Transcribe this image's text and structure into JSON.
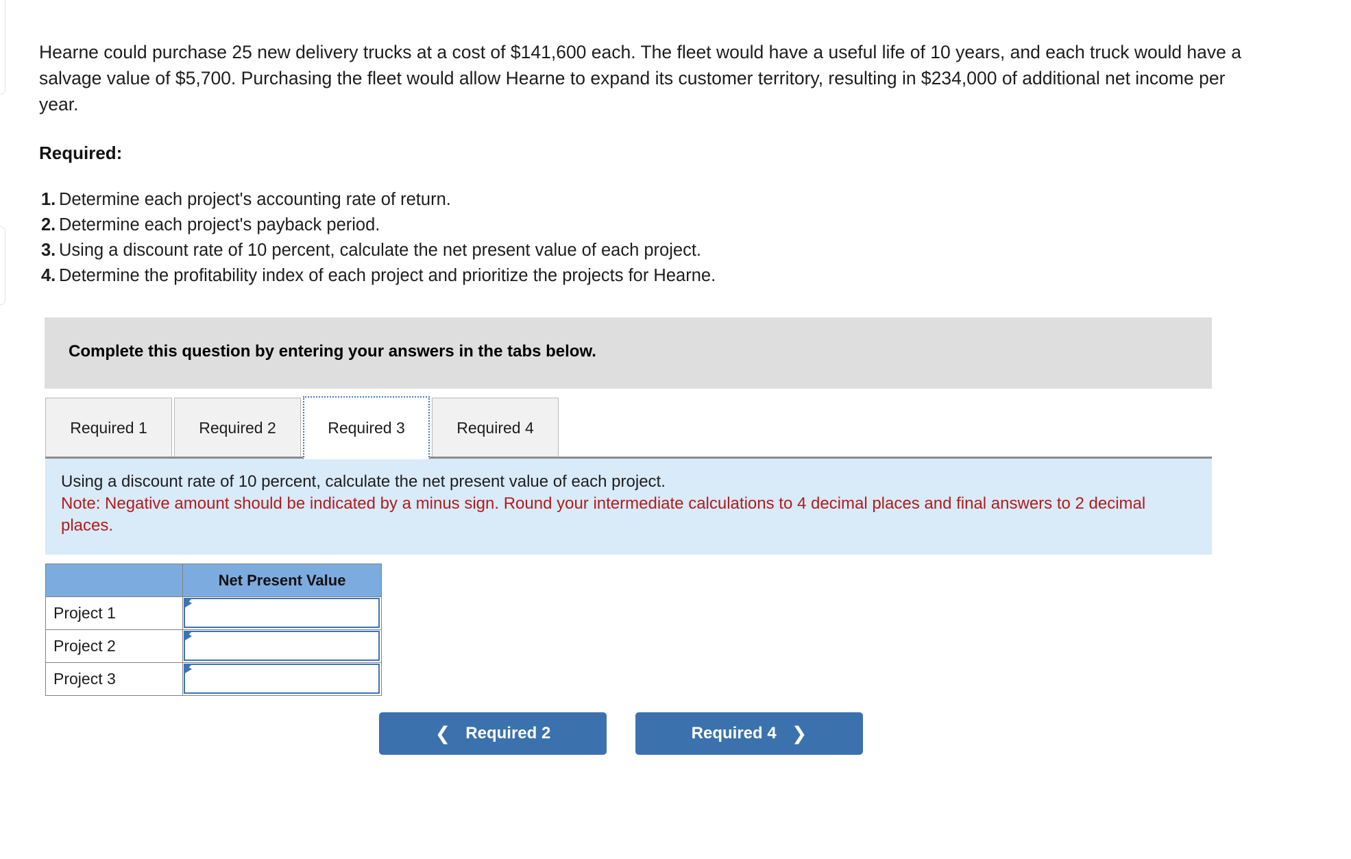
{
  "problem": {
    "paragraph": "Hearne could purchase 25 new delivery trucks at a cost of $141,600 each. The fleet would have a useful life of 10 years, and each truck would have a salvage value of $5,700. Purchasing the fleet would allow Hearne to expand its customer territory, resulting in $234,000 of additional net income per year.",
    "required_heading": "Required:",
    "required_items": [
      {
        "num": "1.",
        "text": "Determine each project's accounting rate of return."
      },
      {
        "num": "2.",
        "text": "Determine each project's payback period."
      },
      {
        "num": "3.",
        "text": "Using a discount rate of 10 percent, calculate the net present value of each project."
      },
      {
        "num": "4.",
        "text": "Determine the profitability index of each project and prioritize the projects for Hearne."
      }
    ]
  },
  "banner": {
    "text": "Complete this question by entering your answers in the tabs below."
  },
  "tabs": {
    "items": [
      {
        "label": "Required 1",
        "active": false
      },
      {
        "label": "Required 2",
        "active": false
      },
      {
        "label": "Required 3",
        "active": true
      },
      {
        "label": "Required 4",
        "active": false
      }
    ]
  },
  "instruction_panel": {
    "line1": "Using a discount rate of 10 percent, calculate the net present value of each project.",
    "note": "Note: Negative amount should be indicated by a minus sign. Round your intermediate calculations to 4 decimal places and final answers to 2 decimal places.",
    "note_color": "#b01c1c",
    "background": "#d9eaf8"
  },
  "answer_table": {
    "header_blank": "",
    "header_npv": "Net Present Value",
    "header_background": "#7cabdf",
    "rows": [
      {
        "label": "Project 1",
        "value": "",
        "placeholder": ""
      },
      {
        "label": "Project 2",
        "value": "",
        "placeholder": ""
      },
      {
        "label": "Project 3",
        "value": "",
        "placeholder": ""
      }
    ]
  },
  "navigation": {
    "prev_label": "Required 2",
    "prev_icon": "chevron-left-icon",
    "next_label": "Required 4",
    "next_icon": "chevron-right-icon",
    "button_color": "#3b72ad"
  }
}
